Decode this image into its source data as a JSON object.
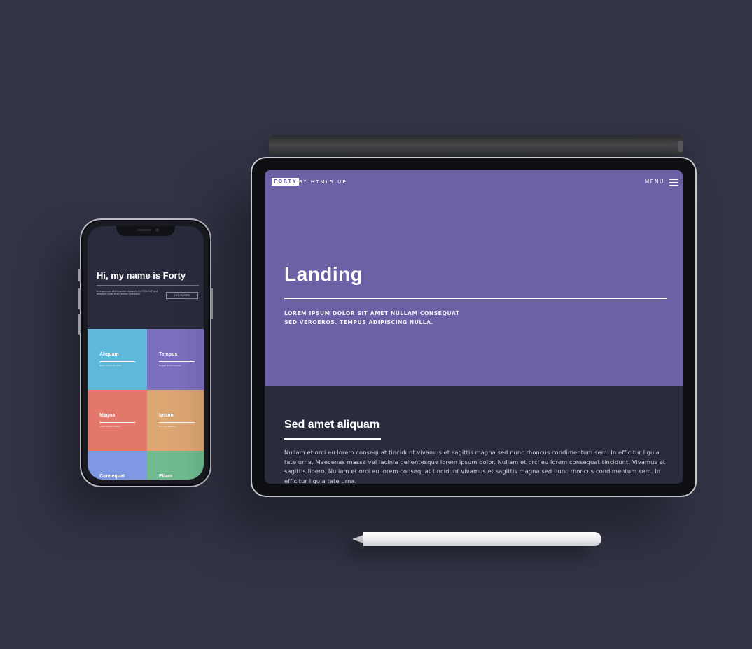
{
  "phone": {
    "hero_title": "Hi, my name is Forty",
    "hero_text": "A responsive site template designed by HTML5 UP and released under the Creative Commons.",
    "hero_button": "GET STARTED",
    "tiles": [
      {
        "label": "Aliquam",
        "sub": "Ipsum dolor sit amet",
        "color": "#5db8d9"
      },
      {
        "label": "Tempus",
        "sub": "feugiat amet tempus",
        "color": "#7b6fbf"
      },
      {
        "label": "Magna",
        "sub": "Lorem etiam nullam",
        "color": "#e3776b"
      },
      {
        "label": "Ipsum",
        "sub": "Nisl sed aliquam",
        "color": "#dca673"
      },
      {
        "label": "Consequat",
        "sub": "",
        "color": "#7e98e4"
      },
      {
        "label": "Etiam",
        "sub": "",
        "color": "#6fbb8f"
      }
    ]
  },
  "tablet": {
    "logo": "FORTY",
    "logo_by": "BY HTML5 UP",
    "menu_label": "MENU",
    "banner_title": "Landing",
    "banner_text_line1": "LOREM IPSUM DOLOR SIT AMET NULLAM CONSEQUAT",
    "banner_text_line2": "SED VEROEROS. TEMPUS ADIPISCING NULLA.",
    "section_title": "Sed amet aliquam",
    "section_text": "Nullam et orci eu lorem consequat tincidunt vivamus et sagittis magna sed nunc rhoncus condimentum sem. In efficitur ligula tate urna. Maecenas massa vel lacinia pellentesque lorem ipsum dolor. Nullam et orci eu lorem consequat tincidunt. Vivamus et sagittis libero. Nullam et orci eu lorem consequat tincidunt vivamus et sagittis magna sed nunc rhoncus condimentum sem. In efficitur ligula tate urna.",
    "banner_color": "#6a62a4"
  },
  "colors": {
    "background": "#323446",
    "page_bg": "#2a2c3d"
  }
}
